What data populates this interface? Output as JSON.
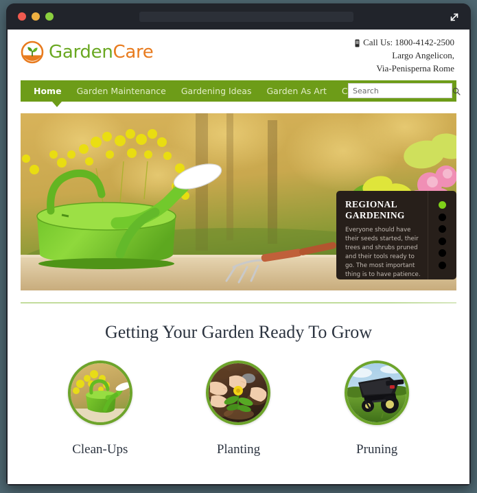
{
  "browser": {
    "window_controls": [
      "close",
      "minimize",
      "maximize"
    ],
    "url_value": "",
    "expand_icon": "expand-diagonal-icon",
    "colors": {
      "chrome": "#21242b",
      "desktop": "#4e6771",
      "light_red": "#f05a4f",
      "light_amber": "#eeb041",
      "light_green": "#8bcf3f"
    }
  },
  "site": {
    "logo": {
      "mark_icon": "leaf-sprout-circle-icon",
      "word_first": "Garden",
      "word_second": "Care",
      "color_first": "#6aa822",
      "color_second": "#e87b1e"
    },
    "contact": {
      "phone_icon": "mobile-phone-icon",
      "phone_line": "Call Us: 1800-4142-2500",
      "address_line1": "Largo Angelicon,",
      "address_line2": "Via-Penisperna Rome"
    },
    "nav": {
      "background": "#6d9c18",
      "items": [
        {
          "label": "Home",
          "active": true
        },
        {
          "label": "Garden Maintenance",
          "active": false
        },
        {
          "label": "Gardening Ideas",
          "active": false
        },
        {
          "label": "Garden As Art",
          "active": false
        },
        {
          "label": "Contact Us",
          "active": false
        }
      ]
    },
    "search": {
      "placeholder": "Search",
      "value": "",
      "icon": "magnifier-icon"
    },
    "hero": {
      "image_alt": "green watering can with yellow flowers on a wooden table, blurred golden garden background, potted pink and red flowers at right",
      "caption": {
        "title_line1": "REGIONAL",
        "title_line2": "GARDENING",
        "body": "Everyone should have their seeds started, their trees and shrubs pruned and their tools ready to go. The most important thing is to have patience.",
        "dots_total": 6,
        "active_dot": 1,
        "active_dot_color": "#7fd119"
      }
    },
    "section": {
      "heading": "Getting Your Garden Ready To Grow",
      "divider_color": "#bfdc9a"
    },
    "services": [
      {
        "label": "Clean-Ups",
        "image_alt": "green watering can among yellow flowers",
        "ring_color": "#6da42b"
      },
      {
        "label": "Planting",
        "image_alt": "hands planting a small yellow flower in dark soil",
        "ring_color": "#6da42b"
      },
      {
        "label": "Pruning",
        "image_alt": "black lawn spreader machine on green grass under blue sky",
        "ring_color": "#6da42b"
      }
    ]
  }
}
